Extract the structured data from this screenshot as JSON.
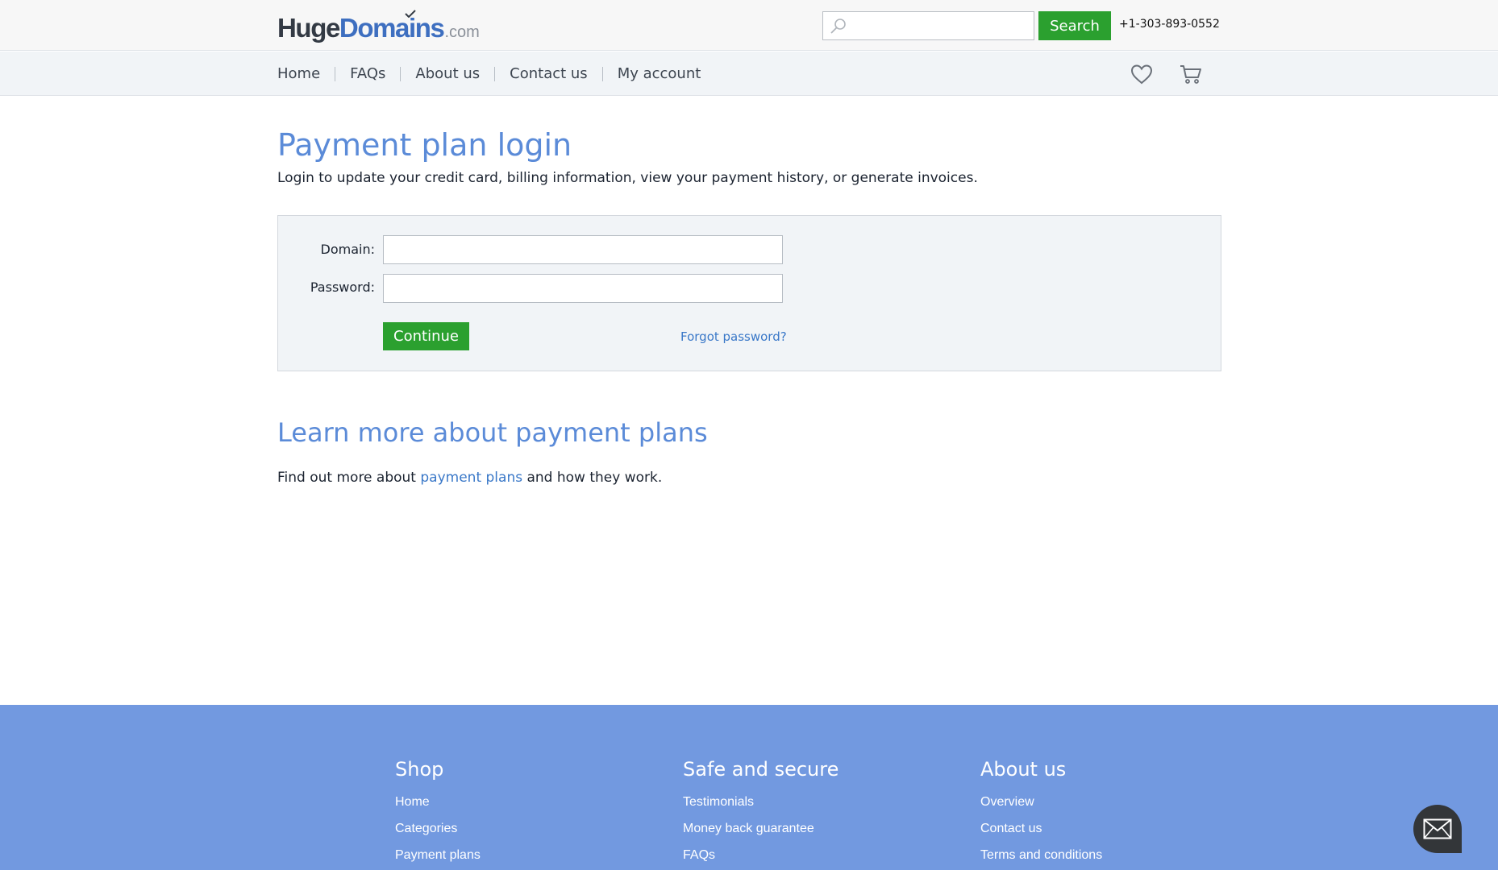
{
  "header": {
    "logo": {
      "part1": "Huge",
      "part2": "Domains",
      "part3": ".com"
    },
    "search": {
      "placeholder": "",
      "button_label": "Search"
    },
    "phone": "+1-303-893-0552"
  },
  "nav": {
    "items": [
      "Home",
      "FAQs",
      "About us",
      "Contact us",
      "My account"
    ],
    "icons": [
      "heart-icon",
      "cart-icon"
    ]
  },
  "main": {
    "title": "Payment plan login",
    "intro": "Login to update your credit card, billing information, view your payment history, or generate invoices.",
    "form": {
      "domain_label": "Domain:",
      "domain_value": "",
      "password_label": "Password:",
      "password_value": "",
      "continue_label": "Continue",
      "forgot_label": "Forgot password?"
    },
    "learn": {
      "title": "Learn more about payment plans",
      "text_before": "Find out more about ",
      "link": "payment plans",
      "text_after": " and how they work."
    }
  },
  "footer": {
    "columns": [
      {
        "title": "Shop",
        "links": [
          "Home",
          "Categories",
          "Payment plans"
        ]
      },
      {
        "title": "Safe and secure",
        "links": [
          "Testimonials",
          "Money back guarantee",
          "FAQs"
        ]
      },
      {
        "title": "About us",
        "links": [
          "Overview",
          "Contact us",
          "Terms and conditions"
        ]
      }
    ]
  },
  "colors": {
    "accent_green": "#2ba02f",
    "link_blue": "#3a78c8",
    "heading_blue": "#5b8bd8",
    "footer_blue": "#7299e0"
  },
  "chat": {
    "icon": "mail-icon"
  }
}
